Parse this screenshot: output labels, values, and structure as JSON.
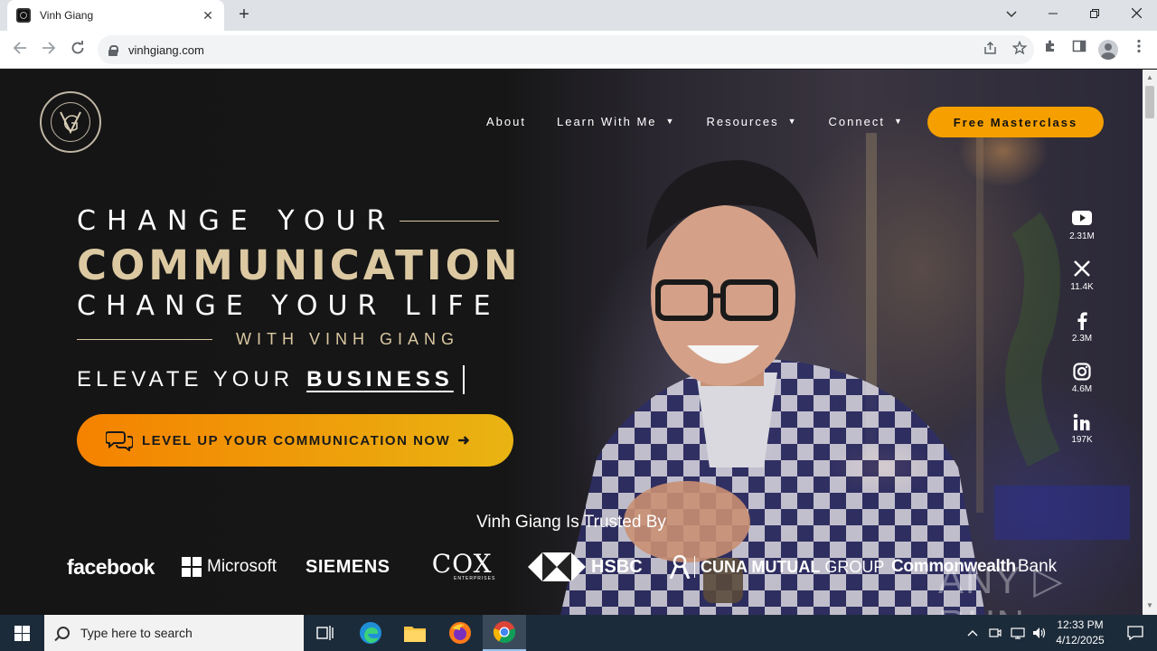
{
  "browser": {
    "tab_title": "Vinh Giang",
    "tab_close": "✕",
    "new_tab": "+",
    "url": "vinhgiang.com",
    "window_controls": {
      "chevron": "⌄",
      "minimize": "—",
      "restore": "❐",
      "close": "✕"
    },
    "icons": [
      "back-icon",
      "forward-icon",
      "reload-icon",
      "lock-icon",
      "share-icon",
      "star-icon",
      "extensions-icon",
      "sidepanel-icon",
      "profile-icon",
      "menu-icon"
    ]
  },
  "site": {
    "nav": {
      "about": "About",
      "learn": "Learn With Me",
      "resources": "Resources",
      "connect": "Connect",
      "cta": "Free Masterclass"
    },
    "hero": {
      "line1": "CHANGE YOUR",
      "line2": "COMMUNICATION",
      "line3": "CHANGE YOUR LIFE",
      "line4": "WITH VINH GIANG",
      "elevate_prefix": "ELEVATE YOUR",
      "elevate_highlight": "BUSINESS",
      "cta": "LEVEL UP YOUR COMMUNICATION NOW"
    },
    "social": [
      {
        "icon": "youtube-icon",
        "count": "2.31M"
      },
      {
        "icon": "x-icon",
        "count": "11.4K"
      },
      {
        "icon": "facebook-icon",
        "count": "2.3M"
      },
      {
        "icon": "instagram-icon",
        "count": "4.6M"
      },
      {
        "icon": "linkedin-icon",
        "count": "197K"
      }
    ],
    "trusted_heading": "Vinh Giang Is Trusted By",
    "logos": {
      "facebook": "facebook",
      "microsoft": "Microsoft",
      "siemens": "SIEMENS",
      "cox": "COX",
      "cox_sub": "ENTERPRISES",
      "hsbc": "HSBC",
      "cuna": "CUNA MUTUAL",
      "cuna_group": "GROUP",
      "commonwealth": "Commonwealth",
      "bank": "Bank"
    },
    "watermark": "ANY ▷ RUN"
  },
  "taskbar": {
    "search_placeholder": "Type here to search",
    "time": "12:33 PM",
    "date": "4/12/2025"
  },
  "colors": {
    "accent_orange": "#f5a000",
    "gold_text": "#dcc9a2",
    "taskbar": "#1c2b3a"
  }
}
